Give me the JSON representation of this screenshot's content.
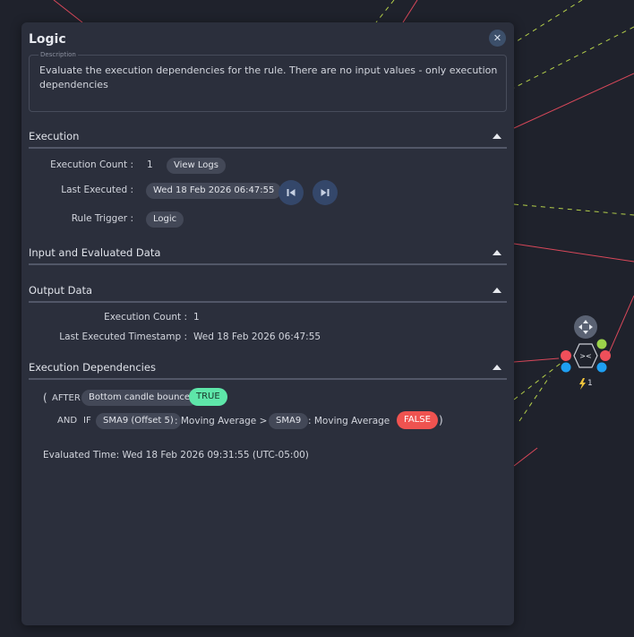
{
  "panel": {
    "title": "Logic",
    "close_label": "✕",
    "description_label": "Description",
    "description": "Evaluate the execution dependencies for the rule. There are no input values - only execution dependencies"
  },
  "execution": {
    "header": "Execution",
    "count_label": "Execution Count :",
    "count_value": "1",
    "view_logs": "View Logs",
    "last_executed_label": "Last Executed :",
    "last_executed_value": "Wed 18 Feb 2026 06:47:55",
    "trigger_label": "Rule Trigger :",
    "trigger_value": "Logic"
  },
  "input_data": {
    "header": "Input and Evaluated Data"
  },
  "output_data": {
    "header": "Output Data",
    "count_label": "Execution Count :",
    "count_value": "1",
    "timestamp_label": "Last Executed Timestamp :",
    "timestamp_value": "Wed 18 Feb 2026 06:47:55"
  },
  "dependencies": {
    "header": "Execution Dependencies",
    "open_paren": "(",
    "after_label": "AFTER",
    "after_chip": "Bottom candle bounce",
    "after_result": "TRUE",
    "and_label": "AND",
    "if_label": "IF",
    "lhs_chip": "SMA9 (Offset 5)",
    "lhs_suffix": ": Moving Average >",
    "rhs_chip": "SMA9",
    "rhs_suffix": ": Moving Average",
    "if_result": "FALSE",
    "close_paren": ")",
    "evaluated_time": "Evaluated Time: Wed 18 Feb 2026 09:31:55 (UTC-05:00)"
  },
  "graph_node": {
    "symbol": "><",
    "count": "1"
  },
  "colors": {
    "background": "#1f222c",
    "panel": "#2b2f3c",
    "true_badge": "#5ee6a9",
    "false_badge": "#ef5350",
    "accent_button": "#34476a"
  },
  "icons": {
    "close": "close-icon",
    "prev": "skip-previous-icon",
    "next": "skip-next-icon",
    "move": "move-arrows-icon",
    "bolt": "lightning-icon",
    "collapse": "chevron-up-icon"
  }
}
